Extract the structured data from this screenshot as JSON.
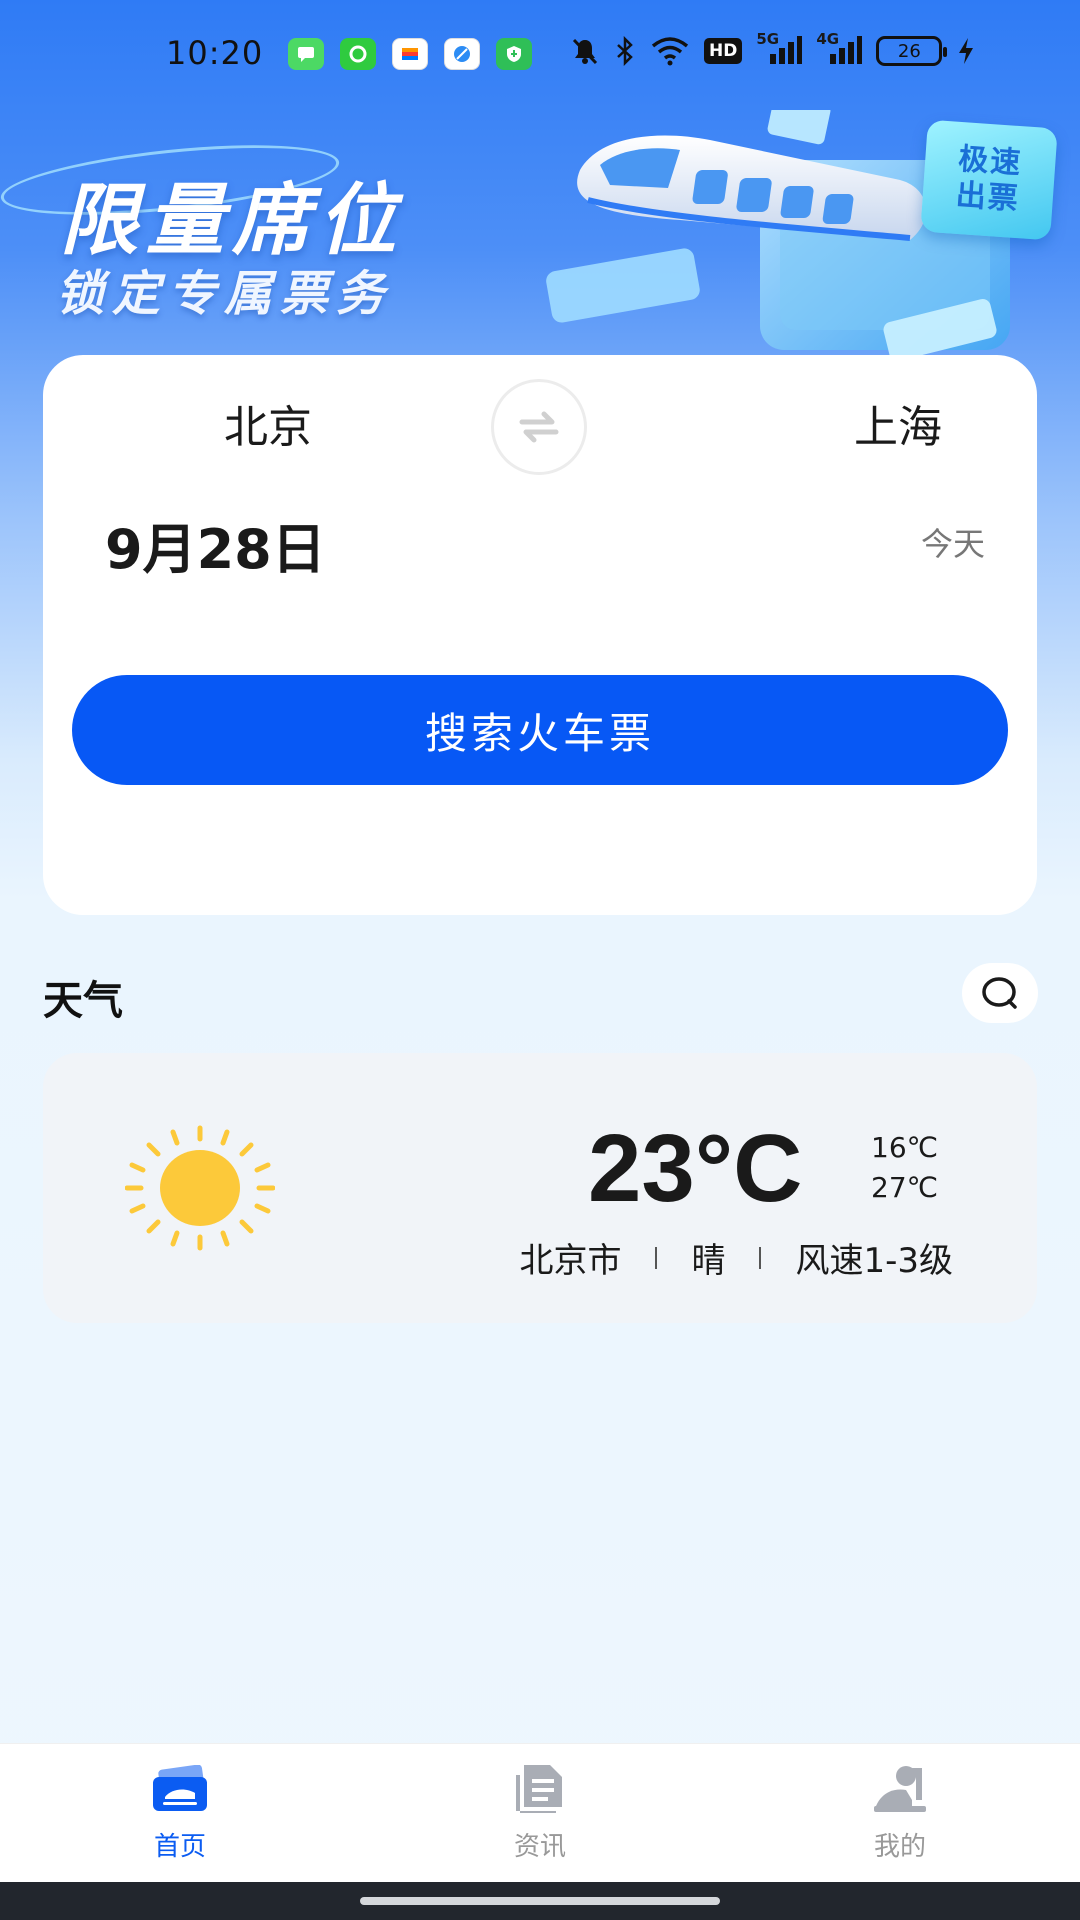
{
  "status_bar": {
    "time": "10:20",
    "notification_icons": [
      "messages-icon",
      "green-app-icon",
      "wallet-icon",
      "browser-icon",
      "security-icon"
    ],
    "system_icons": [
      "mute-icon",
      "bluetooth-icon",
      "wifi-icon",
      "hd-icon",
      "signal-5g-icon",
      "signal-4g-icon"
    ],
    "hd_label": "HD",
    "net1_label": "5G",
    "net2_label": "4G",
    "battery_level": "26"
  },
  "banner": {
    "title": "限量席位",
    "subtitle": "锁定专属票务",
    "badge_line1": "极速",
    "badge_line2": "出票"
  },
  "search": {
    "from_city": "北京",
    "to_city": "上海",
    "date": "9月28日",
    "date_hint": "今天",
    "button_label": "搜索火车票"
  },
  "weather": {
    "heading": "天气",
    "icon": "sun-icon",
    "temperature": "23°C",
    "low": "16℃",
    "high": "27℃",
    "city": "北京市",
    "condition": "晴",
    "wind": "风速1-3级"
  },
  "tabs": [
    {
      "label": "首页",
      "icon": "ticket-icon",
      "active": true
    },
    {
      "label": "资讯",
      "icon": "news-icon",
      "active": false
    },
    {
      "label": "我的",
      "icon": "profile-icon",
      "active": false
    }
  ],
  "colors": {
    "primary": "#0758f5",
    "sun": "#fcc93a",
    "tab_active": "#0b5cf2",
    "tab_inactive": "#999999"
  }
}
